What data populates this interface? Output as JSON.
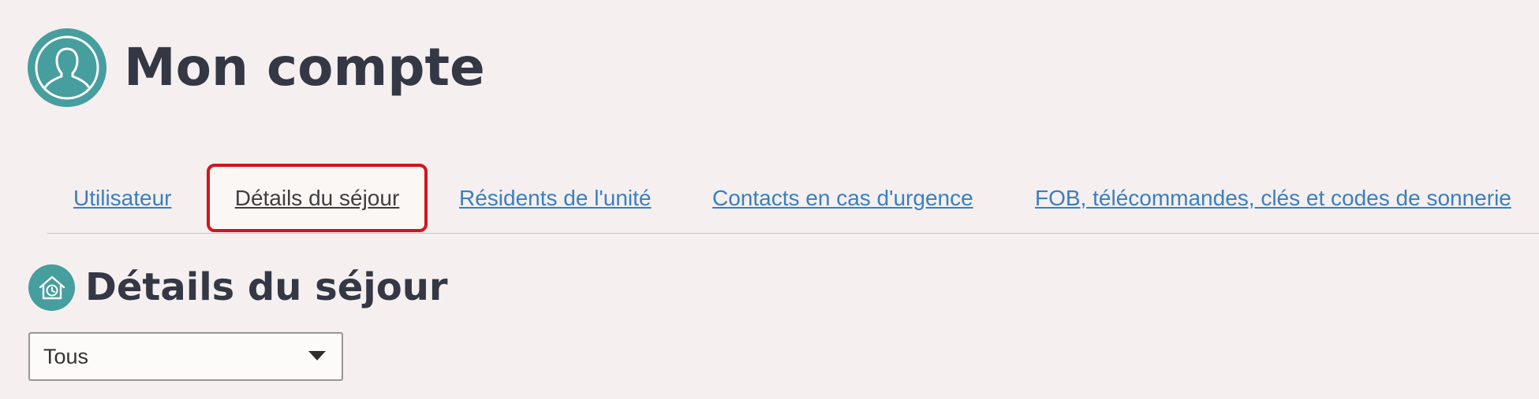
{
  "header": {
    "title": "Mon compte",
    "icon": "user-avatar-icon"
  },
  "tabs": [
    {
      "label": "Utilisateur",
      "selected": false
    },
    {
      "label": "Détails du séjour",
      "selected": true
    },
    {
      "label": "Résidents de l'unité",
      "selected": false
    },
    {
      "label": "Contacts en cas d'urgence",
      "selected": false
    },
    {
      "label": "FOB, télécommandes, clés et codes de sonnerie",
      "selected": false
    }
  ],
  "section": {
    "title": "Détails du séjour",
    "icon": "home-clock-icon"
  },
  "filter": {
    "selected": "Tous"
  },
  "colors": {
    "accent": "#479e9e",
    "link": "#3a7fbf",
    "highlight_border": "#d3141c",
    "background": "#f5efef",
    "text": "#343845"
  }
}
